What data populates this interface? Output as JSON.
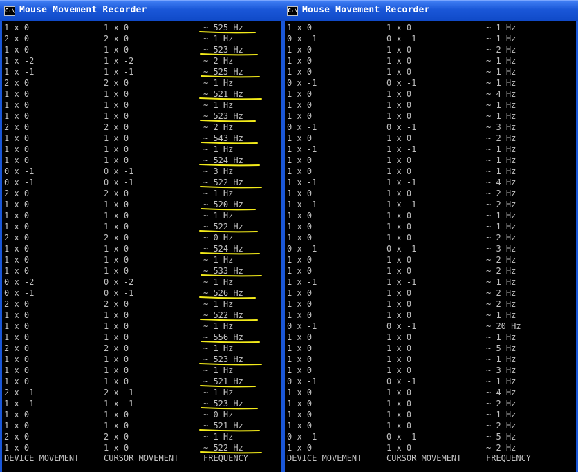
{
  "icon_text": "C:\\",
  "highlight_color": "#f2ea1a",
  "windows": [
    {
      "title": "Mouse Movement Recorder",
      "rows": [
        [
          "1 x 0",
          "1 x 0",
          "~ 525 Hz"
        ],
        [
          "2 x 0",
          "2 x 0",
          "~ 1 Hz"
        ],
        [
          "1 x 0",
          "1 x 0",
          "~ 523 Hz"
        ],
        [
          "1 x -2",
          "1 x -2",
          "~ 2 Hz"
        ],
        [
          "1 x -1",
          "1 x -1",
          "~ 525 Hz"
        ],
        [
          "2 x 0",
          "2 x 0",
          "~ 1 Hz"
        ],
        [
          "1 x 0",
          "1 x 0",
          "~ 521 Hz"
        ],
        [
          "1 x 0",
          "1 x 0",
          "~ 1 Hz"
        ],
        [
          "1 x 0",
          "1 x 0",
          "~ 523 Hz"
        ],
        [
          "2 x 0",
          "2 x 0",
          "~ 2 Hz"
        ],
        [
          "1 x 0",
          "1 x 0",
          "~ 543 Hz"
        ],
        [
          "1 x 0",
          "1 x 0",
          "~ 1 Hz"
        ],
        [
          "1 x 0",
          "1 x 0",
          "~ 524 Hz"
        ],
        [
          "0 x -1",
          "0 x -1",
          "~ 3 Hz"
        ],
        [
          "0 x -1",
          "0 x -1",
          "~ 522 Hz"
        ],
        [
          "2 x 0",
          "2 x 0",
          "~ 1 Hz"
        ],
        [
          "1 x 0",
          "1 x 0",
          "~ 520 Hz"
        ],
        [
          "1 x 0",
          "1 x 0",
          "~ 1 Hz"
        ],
        [
          "1 x 0",
          "1 x 0",
          "~ 522 Hz"
        ],
        [
          "2 x 0",
          "2 x 0",
          "~ 0 Hz"
        ],
        [
          "1 x 0",
          "1 x 0",
          "~ 524 Hz"
        ],
        [
          "1 x 0",
          "1 x 0",
          "~ 1 Hz"
        ],
        [
          "1 x 0",
          "1 x 0",
          "~ 533 Hz"
        ],
        [
          "0 x -2",
          "0 x -2",
          "~ 1 Hz"
        ],
        [
          "0 x -1",
          "0 x -1",
          "~ 526 Hz"
        ],
        [
          "2 x 0",
          "2 x 0",
          "~ 1 Hz"
        ],
        [
          "1 x 0",
          "1 x 0",
          "~ 522 Hz"
        ],
        [
          "1 x 0",
          "1 x 0",
          "~ 1 Hz"
        ],
        [
          "1 x 0",
          "1 x 0",
          "~ 556 Hz"
        ],
        [
          "2 x 0",
          "2 x 0",
          "~ 1 Hz"
        ],
        [
          "1 x 0",
          "1 x 0",
          "~ 523 Hz"
        ],
        [
          "1 x 0",
          "1 x 0",
          "~ 1 Hz"
        ],
        [
          "1 x 0",
          "1 x 0",
          "~ 521 Hz"
        ],
        [
          "2 x -1",
          "2 x -1",
          "~ 1 Hz"
        ],
        [
          "1 x -1",
          "1 x -1",
          "~ 523 Hz"
        ],
        [
          "1 x 0",
          "1 x 0",
          "~ 0 Hz"
        ],
        [
          "1 x 0",
          "1 x 0",
          "~ 521 Hz"
        ],
        [
          "2 x 0",
          "2 x 0",
          "~ 1 Hz"
        ],
        [
          "1 x 0",
          "1 x 0",
          "~ 522 Hz"
        ]
      ],
      "footer": [
        "DEVICE MOVEMENT",
        "CURSOR MOVEMENT",
        "FREQUENCY"
      ]
    },
    {
      "title": "Mouse Movement Recorder",
      "rows": [
        [
          "1 x 0",
          "1 x 0",
          "~ 1 Hz"
        ],
        [
          "0 x -1",
          "0 x -1",
          "~ 1 Hz"
        ],
        [
          "1 x 0",
          "1 x 0",
          "~ 2 Hz"
        ],
        [
          "1 x 0",
          "1 x 0",
          "~ 1 Hz"
        ],
        [
          "1 x 0",
          "1 x 0",
          "~ 1 Hz"
        ],
        [
          "0 x -1",
          "0 x -1",
          "~ 1 Hz"
        ],
        [
          "1 x 0",
          "1 x 0",
          "~ 4 Hz"
        ],
        [
          "1 x 0",
          "1 x 0",
          "~ 1 Hz"
        ],
        [
          "1 x 0",
          "1 x 0",
          "~ 1 Hz"
        ],
        [
          "0 x -1",
          "0 x -1",
          "~ 3 Hz"
        ],
        [
          "1 x 0",
          "1 x 0",
          "~ 2 Hz"
        ],
        [
          "1 x -1",
          "1 x -1",
          "~ 1 Hz"
        ],
        [
          "1 x 0",
          "1 x 0",
          "~ 1 Hz"
        ],
        [
          "1 x 0",
          "1 x 0",
          "~ 1 Hz"
        ],
        [
          "1 x -1",
          "1 x -1",
          "~ 4 Hz"
        ],
        [
          "1 x 0",
          "1 x 0",
          "~ 2 Hz"
        ],
        [
          "1 x -1",
          "1 x -1",
          "~ 2 Hz"
        ],
        [
          "1 x 0",
          "1 x 0",
          "~ 1 Hz"
        ],
        [
          "1 x 0",
          "1 x 0",
          "~ 1 Hz"
        ],
        [
          "1 x 0",
          "1 x 0",
          "~ 2 Hz"
        ],
        [
          "0 x -1",
          "0 x -1",
          "~ 3 Hz"
        ],
        [
          "1 x 0",
          "1 x 0",
          "~ 2 Hz"
        ],
        [
          "1 x 0",
          "1 x 0",
          "~ 2 Hz"
        ],
        [
          "1 x -1",
          "1 x -1",
          "~ 1 Hz"
        ],
        [
          "1 x 0",
          "1 x 0",
          "~ 2 Hz"
        ],
        [
          "1 x 0",
          "1 x 0",
          "~ 2 Hz"
        ],
        [
          "1 x 0",
          "1 x 0",
          "~ 1 Hz"
        ],
        [
          "0 x -1",
          "0 x -1",
          "~ 20 Hz"
        ],
        [
          "1 x 0",
          "1 x 0",
          "~ 1 Hz"
        ],
        [
          "1 x 0",
          "1 x 0",
          "~ 5 Hz"
        ],
        [
          "1 x 0",
          "1 x 0",
          "~ 1 Hz"
        ],
        [
          "1 x 0",
          "1 x 0",
          "~ 3 Hz"
        ],
        [
          "0 x -1",
          "0 x -1",
          "~ 1 Hz"
        ],
        [
          "1 x 0",
          "1 x 0",
          "~ 4 Hz"
        ],
        [
          "1 x 0",
          "1 x 0",
          "~ 2 Hz"
        ],
        [
          "1 x 0",
          "1 x 0",
          "~ 1 Hz"
        ],
        [
          "1 x 0",
          "1 x 0",
          "~ 2 Hz"
        ],
        [
          "0 x -1",
          "0 x -1",
          "~ 5 Hz"
        ],
        [
          "1 x 0",
          "1 x 0",
          "~ 2 Hz"
        ]
      ],
      "footer": [
        "DEVICE MOVEMENT",
        "CURSOR MOVEMENT",
        "FREQUENCY"
      ]
    }
  ]
}
